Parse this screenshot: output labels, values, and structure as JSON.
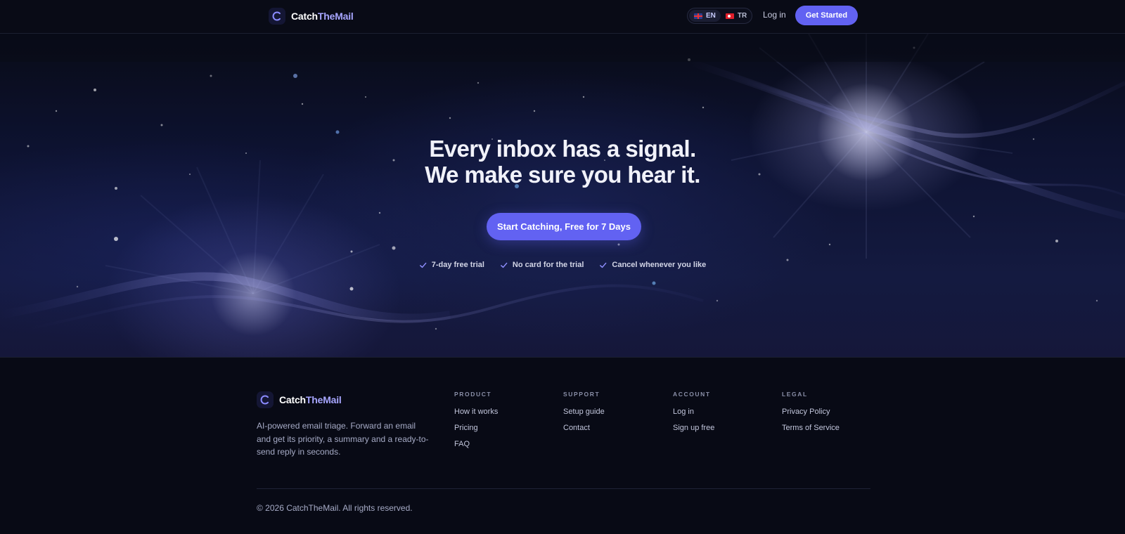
{
  "brand": {
    "name_part1": "Catch",
    "name_part2": "TheMail",
    "logo_icon": "logo-c-icon"
  },
  "nav": {
    "languages": [
      {
        "code": "EN",
        "flag": "uk-flag-icon",
        "active": true
      },
      {
        "code": "TR",
        "flag": "tr-flag-icon",
        "active": false
      }
    ],
    "login_label": "Log in",
    "cta_label": "Get Started"
  },
  "hero": {
    "title_line1": "Every inbox has a signal.",
    "title_line2": "We make sure you hear it.",
    "cta_label": "Start Catching, Free for 7 Days",
    "perks": [
      "7-day free trial",
      "No card for the trial",
      "Cancel whenever you like"
    ]
  },
  "footer": {
    "description": "AI-powered email triage. Forward an email and get its priority, a summary and a ready-to-send reply in seconds.",
    "columns": [
      {
        "heading": "PRODUCT",
        "links": [
          "How it works",
          "Pricing",
          "FAQ"
        ]
      },
      {
        "heading": "SUPPORT",
        "links": [
          "Setup guide",
          "Contact"
        ]
      },
      {
        "heading": "ACCOUNT",
        "links": [
          "Log in",
          "Sign up free"
        ]
      },
      {
        "heading": "LEGAL",
        "links": [
          "Privacy Policy",
          "Terms of Service"
        ]
      }
    ],
    "copyright": "© 2026 CatchTheMail. All rights reserved."
  },
  "colors": {
    "accent": "#6262f2",
    "brand_secondary": "#a7a6ff",
    "background": "#080a15"
  }
}
